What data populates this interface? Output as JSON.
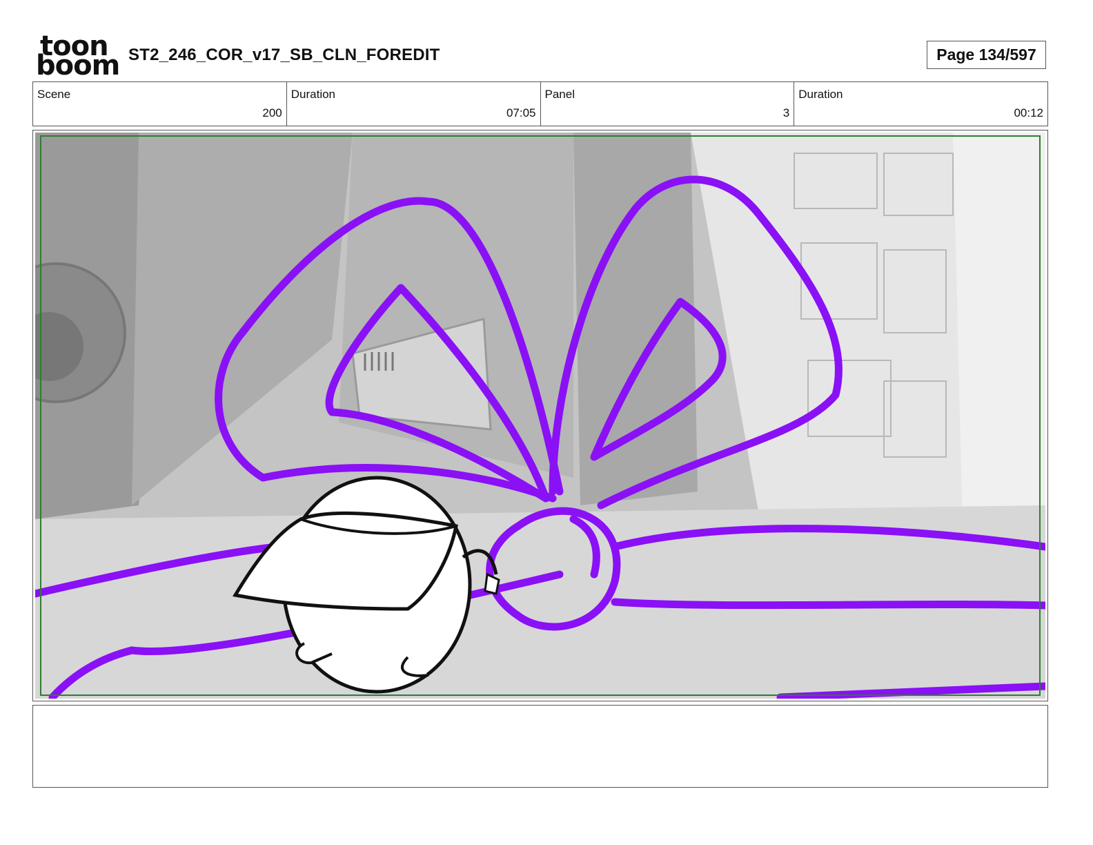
{
  "header": {
    "logo_top": "toon",
    "logo_bottom": "boom",
    "title": "ST2_246_COR_v17_SB_CLN_FOREDIT",
    "page": "Page 134/597"
  },
  "info": {
    "scene_label": "Scene",
    "scene_value": "200",
    "scene_duration_label": "Duration",
    "scene_duration_value": "07:05",
    "panel_label": "Panel",
    "panel_value": "3",
    "panel_duration_label": "Duration",
    "panel_duration_value": "00:12"
  },
  "notes": {
    "text": ""
  },
  "colors": {
    "ribbon": "#8a10f5",
    "safe_frame": "#2e7d32",
    "border": "#555555"
  }
}
